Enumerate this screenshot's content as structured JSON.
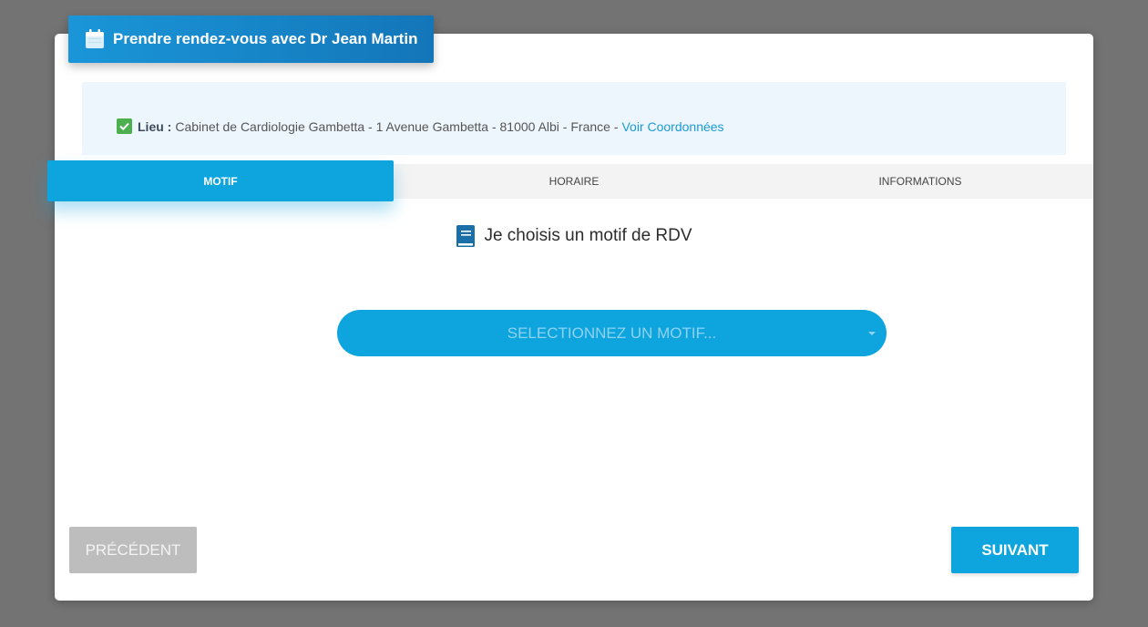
{
  "header": {
    "title": "Prendre rendez-vous avec Dr Jean Martin",
    "icon": "calendar-icon"
  },
  "location": {
    "label": "Lieu :",
    "address": "Cabinet de Cardiologie Gambetta - 1 Avenue Gambetta - 81000 Albi - France -",
    "link_text": "Voir Coordonnées",
    "icon": "check-square-icon"
  },
  "tabs": [
    {
      "label": "MOTIF",
      "active": true
    },
    {
      "label": "HORAIRE",
      "active": false
    },
    {
      "label": "INFORMATIONS",
      "active": false
    }
  ],
  "section": {
    "title": "Je choisis un motif de RDV",
    "icon": "book-icon"
  },
  "motif_select": {
    "placeholder": "SELECTIONNEZ UN MOTIF..."
  },
  "footer": {
    "prev_label": "PRÉCÉDENT",
    "next_label": "SUIVANT"
  },
  "colors": {
    "accent": "#0ea4dd",
    "title_gradient_start": "#1a96d8",
    "title_gradient_end": "#1376b9",
    "overlay": "#737373",
    "location_bg": "#eef6fd",
    "check_green": "#4caf50",
    "disabled_button": "#bdbdbd"
  }
}
